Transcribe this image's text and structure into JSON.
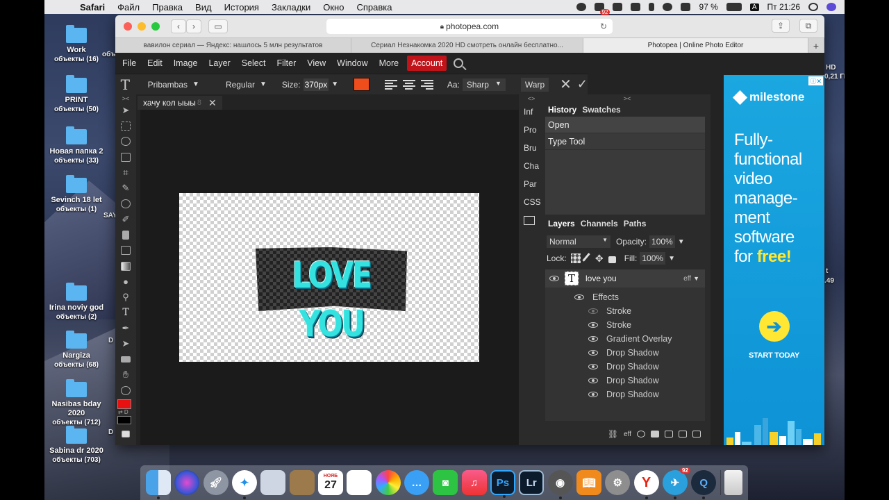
{
  "menubar": {
    "apple_glyph": "",
    "app": "Safari",
    "items": [
      "Файл",
      "Правка",
      "Вид",
      "История",
      "Закладки",
      "Окно",
      "Справка"
    ],
    "battery": "97 %",
    "input_source": "A",
    "clock": "Пт 21:26",
    "badge": "92"
  },
  "desktop": {
    "icons": [
      {
        "name": "Work",
        "count": "объекты (16)"
      },
      {
        "name": "PRINT",
        "count": "объекты (50)"
      },
      {
        "name": "Новая папка 2",
        "count": "объекты (33)"
      },
      {
        "name": "Sevinch 18 let",
        "count": "объекты (1)"
      },
      {
        "name": "Irina noviy god",
        "count": "объекты (2)"
      },
      {
        "name": "Nargiza",
        "count": "объекты (68)"
      },
      {
        "name": "Nasibas bday 2020",
        "count": "объекты (712)"
      },
      {
        "name": "Sabina dr 2020",
        "count": "объекты (703)"
      }
    ],
    "clipped_left": [
      "объекты",
      "SAY",
      "D",
      "D"
    ],
    "clipped_right": [
      "HD",
      "0,21 ГБ",
      "t",
      ".49"
    ]
  },
  "browser": {
    "url": "photopea.com",
    "tabs": [
      "вавилон сериал — Яндекс: нашлось 5 млн результатов",
      "Сериал Незнакомка 2020 HD смотреть онлайн бесплатно...",
      "Photopea | Online Photo Editor"
    ],
    "new_tab": "+"
  },
  "photopea": {
    "menu": [
      "File",
      "Edit",
      "Image",
      "Layer",
      "Select",
      "Filter",
      "View",
      "Window",
      "More"
    ],
    "account": "Account",
    "options": {
      "tool_glyph": "T",
      "font": "Pribambas",
      "style": "Regular",
      "size_label": "Size:",
      "size_value": "370px",
      "text_color": "#f04d1c",
      "aa_label": "Aa:",
      "aa_value": "Sharp",
      "warp": "Warp"
    },
    "document": {
      "tab_title": "хачу кол ыыы",
      "tab_number": "8",
      "text": "LOVE YOU"
    },
    "tool_text_glyph": "T",
    "fg_color": "#e81010",
    "bg_color": "#000000",
    "panel_strip": [
      "Inf",
      "Pro",
      "Bru",
      "Cha",
      "Par",
      "CSS"
    ],
    "history": {
      "tabs": [
        "History",
        "Swatches"
      ],
      "items": [
        "Open",
        "Type Tool"
      ]
    },
    "layers": {
      "tabs": [
        "Layers",
        "Channels",
        "Paths"
      ],
      "blend_mode": "Normal",
      "opacity_label": "Opacity:",
      "opacity": "100%",
      "lock_label": "Lock:",
      "fill_label": "Fill:",
      "fill": "100%",
      "layer_name": "love you",
      "eff_label": "eff",
      "effects_label": "Effects",
      "effects": [
        "Stroke",
        "Stroke",
        "Gradient Overlay",
        "Drop Shadow",
        "Drop Shadow",
        "Drop Shadow",
        "Drop Shadow"
      ],
      "footer_eff": "eff"
    }
  },
  "ad": {
    "brand": "milestone",
    "headline_1": "Fully-",
    "headline_2": "functional",
    "headline_3": "video",
    "headline_4": "manage-",
    "headline_5": "ment",
    "headline_6": "software",
    "headline_7": "for",
    "headline_free": "free!",
    "cta": "START TODAY"
  },
  "dock": {
    "calendar_month": "НОЯБ",
    "calendar_day": "27",
    "badge": "92",
    "ps_label": "Ps",
    "lr_label": "Lr"
  }
}
